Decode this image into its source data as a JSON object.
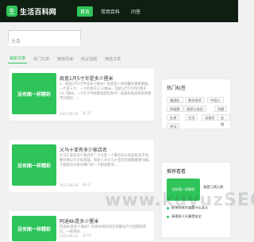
{
  "header": {
    "brand": "生活百科网",
    "logo_badge": "生",
    "nav": [
      {
        "label": "首页",
        "active": true
      },
      {
        "label": "常用百科",
        "active": false
      },
      {
        "label": "问答",
        "active": false
      }
    ]
  },
  "search": {
    "value": "头条"
  },
  "tabs": [
    {
      "label": "最新文章",
      "active": true
    },
    {
      "label": "热门文章",
      "active": false
    },
    {
      "label": "推荐阅读",
      "active": false
    },
    {
      "label": "热议话题",
      "active": false
    },
    {
      "label": "精选文章",
      "active": false
    }
  ],
  "cards": [
    {
      "thumb_text": "没有图一样精彩",
      "title": "肩宽1尺5寸半是多少厘米",
      "excerpt": "1、肩宽1尺5寸半是多少厘米？肩宽是人体测量的重要数据，一尺是十寸，一寸约等于3.33厘米，因此1尺5寸半约等于51.7厘米。一尺5寸半肩膀宽度标准吗？肩宽标准因身高体重不同而异……",
      "meta_a": "2023-06-29",
      "meta_b": "阅 25"
    },
    {
      "thumb_text": "没有图一样精彩",
      "title": "义乌十亚有多少家店名",
      "excerpt": "义乌十亚有多少家店名？义乌是一个著名的小商品批发市场，拥有数以万计的商铺。很多人对义乌十亚的店铺数量感兴趣，下面就为大家详细介绍一下相关情况……",
      "meta_a": "2023-06-29",
      "meta_b": "阅 31"
    },
    {
      "thumb_text": "没有图一样精彩",
      "title": "阿迪8k是多少厘米",
      "excerpt": "阿迪8k是多少厘米？阿迪8k鞋码对应的脚长尺寸因鞋款而异，一般来说……",
      "meta_a": "2023-06-29",
      "meta_b": "阅 18"
    }
  ],
  "hot_tags": {
    "title": "热门标签",
    "tags": [
      "美国队",
      "数学老师",
      "中国人",
      "四级题",
      "国家公务员",
      "问题",
      "社保",
      "生活",
      "诺基亚",
      "金融",
      "考试"
    ]
  },
  "recommend": {
    "title": "推荐看看",
    "items": [
      {
        "thumb": "没有图一样精彩",
        "title": "酒是几两几两"
      },
      {
        "thumb": "没有图一样精彩",
        "title": "胖掉到体内卖是什么含义"
      },
      {
        "thumb": "没有图一样精彩",
        "title": "清理多少天算是安全"
      }
    ]
  },
  "watermark": "www.kuyuzSEO"
}
